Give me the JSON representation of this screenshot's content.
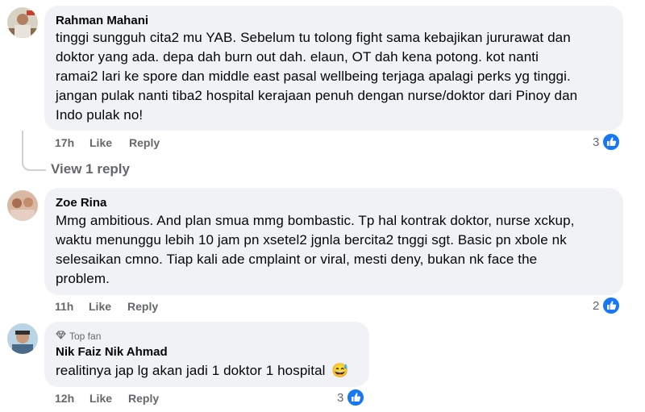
{
  "comments": [
    {
      "author": "Rahman Mahani",
      "lines": [
        "tinggi sungguh cita2 mu YAB. Sebelum tu tolong fight sama kebajikan jururawat dan",
        "doktor yang ada. depa dah burn out dah. elaun, OT dah kena potong. kot nanti",
        "ramai2 lari ke spore dan middle east pasal wellbeing terjaga apalagi perks yg tinggi.",
        "jangan pulak nanti tiba2 hospital kerajaan penuh dengan nurse/doktor dari Pinoy dan",
        "Indo pulak no!"
      ],
      "time": "17h",
      "like_label": "Like",
      "reply_label": "Reply",
      "reaction_count": "3",
      "reaction_icon": "like-icon",
      "view_replies": "View 1 reply"
    },
    {
      "author": "Zoe Rina",
      "lines": [
        "Mmg ambitious. And plan smua mmg bombastic. Tp hal kontrak doktor, nurse xckup,",
        "waktu menunggu lebih 10 jam pn xsetel2 jgnla bercita2 tnggi sgt. Basic pn xbole nk",
        "selesaikan cmno. Tiap kali ade cmplaint or viral, mesti deny, bukan nk face the",
        "problem."
      ],
      "time": "11h",
      "like_label": "Like",
      "reply_label": "Reply",
      "reaction_count": "2",
      "reaction_icon": "like-icon"
    },
    {
      "badge": "Top fan",
      "badge_icon": "diamond-icon",
      "author": "Nik Faiz Nik Ahmad",
      "lines": [
        "realitinya jap lg akan jadi 1 doktor 1 hospital"
      ],
      "emoji": "😅",
      "time": "12h",
      "like_label": "Like",
      "reply_label": "Reply",
      "reaction_count": "3",
      "reaction_icon": "like-icon"
    }
  ],
  "colors": {
    "bubble": "#f0f2f5",
    "secondary_text": "#65676b",
    "like_blue": "#1877f2"
  }
}
